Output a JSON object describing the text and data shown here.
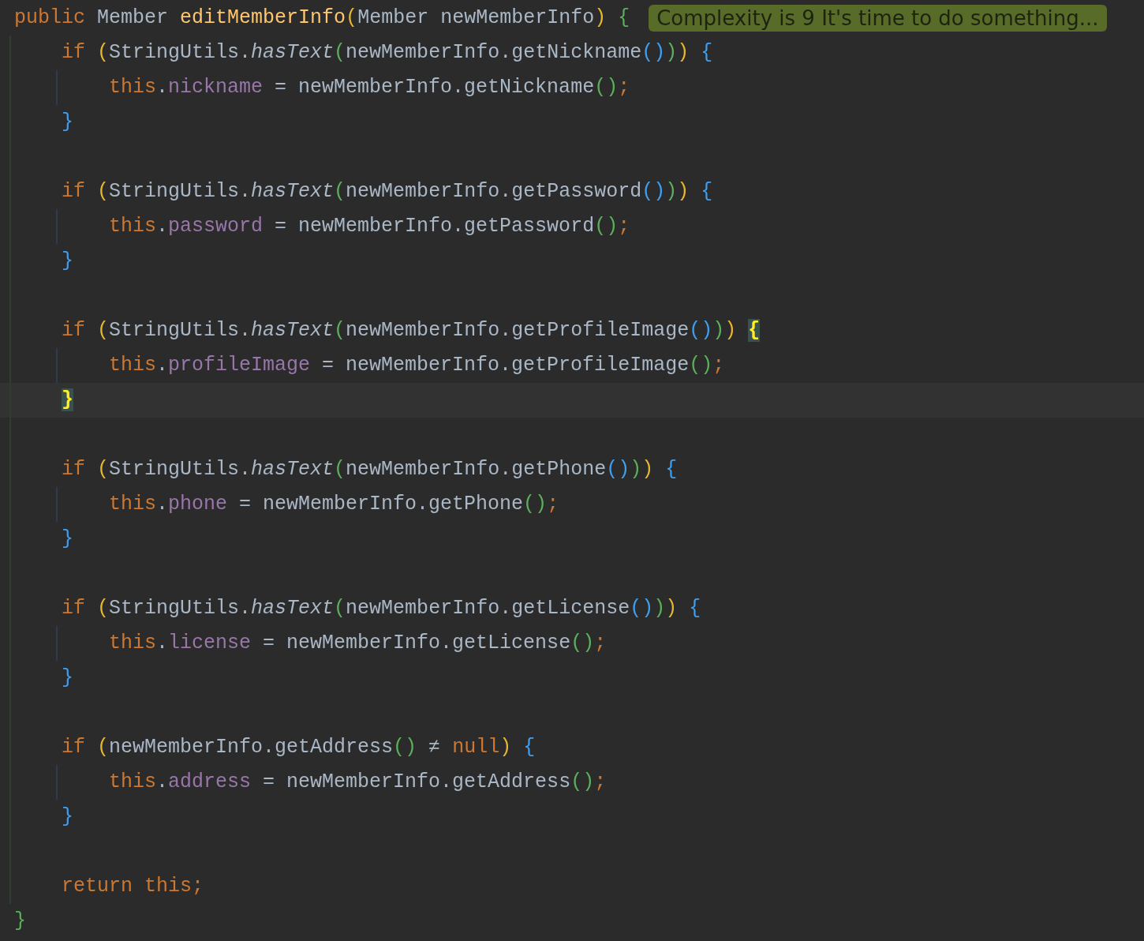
{
  "hint": {
    "text": "Complexity is 9 It's time to do something..."
  },
  "lines": [
    {
      "kind": "top",
      "tokens": [
        {
          "text": "public ",
          "kind": "keyword"
        },
        {
          "text": "Member ",
          "kind": "plain"
        },
        {
          "text": "editMemberInfo",
          "kind": "decl"
        },
        {
          "text": "(",
          "kind": "p1"
        },
        {
          "text": "Member newMemberInfo",
          "kind": "plain"
        },
        {
          "text": ") ",
          "kind": "p1"
        },
        {
          "text": "{",
          "kind": "p2"
        }
      ]
    },
    {
      "kind": "block",
      "tokens": [
        {
          "text": "if ",
          "kind": "keyword"
        },
        {
          "text": "(",
          "kind": "p1"
        },
        {
          "text": "StringUtils.",
          "kind": "plain"
        },
        {
          "text": "hasText",
          "kind": "static"
        },
        {
          "text": "(",
          "kind": "p2"
        },
        {
          "text": "newMemberInfo.getNickname",
          "kind": "plain"
        },
        {
          "text": "()",
          "kind": "p3"
        },
        {
          "text": ")",
          "kind": "p2"
        },
        {
          "text": ") ",
          "kind": "p1"
        },
        {
          "text": "{",
          "kind": "p3"
        }
      ]
    },
    {
      "kind": "body",
      "tokens": [
        {
          "text": "this",
          "kind": "keyword"
        },
        {
          "text": ".",
          "kind": "plain"
        },
        {
          "text": "nickname",
          "kind": "field"
        },
        {
          "text": " = newMemberInfo.getNickname",
          "kind": "plain"
        },
        {
          "text": "()",
          "kind": "p2"
        },
        {
          "text": ";",
          "kind": "keyword"
        }
      ]
    },
    {
      "kind": "block",
      "tokens": [
        {
          "text": "}",
          "kind": "p3"
        }
      ]
    },
    {
      "kind": "blank"
    },
    {
      "kind": "block",
      "tokens": [
        {
          "text": "if ",
          "kind": "keyword"
        },
        {
          "text": "(",
          "kind": "p1"
        },
        {
          "text": "StringUtils.",
          "kind": "plain"
        },
        {
          "text": "hasText",
          "kind": "static"
        },
        {
          "text": "(",
          "kind": "p2"
        },
        {
          "text": "newMemberInfo.getPassword",
          "kind": "plain"
        },
        {
          "text": "()",
          "kind": "p3"
        },
        {
          "text": ")",
          "kind": "p2"
        },
        {
          "text": ") ",
          "kind": "p1"
        },
        {
          "text": "{",
          "kind": "p3"
        }
      ]
    },
    {
      "kind": "body",
      "tokens": [
        {
          "text": "this",
          "kind": "keyword"
        },
        {
          "text": ".",
          "kind": "plain"
        },
        {
          "text": "password",
          "kind": "field"
        },
        {
          "text": " = newMemberInfo.getPassword",
          "kind": "plain"
        },
        {
          "text": "()",
          "kind": "p2"
        },
        {
          "text": ";",
          "kind": "keyword"
        }
      ]
    },
    {
      "kind": "block",
      "tokens": [
        {
          "text": "}",
          "kind": "p3"
        }
      ]
    },
    {
      "kind": "blank"
    },
    {
      "kind": "block",
      "tokens": [
        {
          "text": "if ",
          "kind": "keyword"
        },
        {
          "text": "(",
          "kind": "p1"
        },
        {
          "text": "StringUtils.",
          "kind": "plain"
        },
        {
          "text": "hasText",
          "kind": "static"
        },
        {
          "text": "(",
          "kind": "p2"
        },
        {
          "text": "newMemberInfo.getProfileImage",
          "kind": "plain"
        },
        {
          "text": "()",
          "kind": "p3"
        },
        {
          "text": ")",
          "kind": "p2"
        },
        {
          "text": ") ",
          "kind": "p1"
        },
        {
          "text": "{",
          "matched": true
        }
      ]
    },
    {
      "kind": "body",
      "tokens": [
        {
          "text": "this",
          "kind": "keyword"
        },
        {
          "text": ".",
          "kind": "plain"
        },
        {
          "text": "profileImage",
          "kind": "field"
        },
        {
          "text": " = newMemberInfo.getProfileImage",
          "kind": "plain"
        },
        {
          "text": "()",
          "kind": "p2"
        },
        {
          "text": ";",
          "kind": "keyword"
        }
      ]
    },
    {
      "kind": "block",
      "current": true,
      "tokens": [
        {
          "text": "}",
          "matched": true
        }
      ]
    },
    {
      "kind": "blank"
    },
    {
      "kind": "block",
      "tokens": [
        {
          "text": "if ",
          "kind": "keyword"
        },
        {
          "text": "(",
          "kind": "p1"
        },
        {
          "text": "StringUtils.",
          "kind": "plain"
        },
        {
          "text": "hasText",
          "kind": "static"
        },
        {
          "text": "(",
          "kind": "p2"
        },
        {
          "text": "newMemberInfo.getPhone",
          "kind": "plain"
        },
        {
          "text": "()",
          "kind": "p3"
        },
        {
          "text": ")",
          "kind": "p2"
        },
        {
          "text": ") ",
          "kind": "p1"
        },
        {
          "text": "{",
          "kind": "p3"
        }
      ]
    },
    {
      "kind": "body",
      "tokens": [
        {
          "text": "this",
          "kind": "keyword"
        },
        {
          "text": ".",
          "kind": "plain"
        },
        {
          "text": "phone",
          "kind": "field"
        },
        {
          "text": " = newMemberInfo.getPhone",
          "kind": "plain"
        },
        {
          "text": "()",
          "kind": "p2"
        },
        {
          "text": ";",
          "kind": "keyword"
        }
      ]
    },
    {
      "kind": "block",
      "tokens": [
        {
          "text": "}",
          "kind": "p3"
        }
      ]
    },
    {
      "kind": "blank"
    },
    {
      "kind": "block",
      "tokens": [
        {
          "text": "if ",
          "kind": "keyword"
        },
        {
          "text": "(",
          "kind": "p1"
        },
        {
          "text": "StringUtils.",
          "kind": "plain"
        },
        {
          "text": "hasText",
          "kind": "static"
        },
        {
          "text": "(",
          "kind": "p2"
        },
        {
          "text": "newMemberInfo.getLicense",
          "kind": "plain"
        },
        {
          "text": "()",
          "kind": "p3"
        },
        {
          "text": ")",
          "kind": "p2"
        },
        {
          "text": ") ",
          "kind": "p1"
        },
        {
          "text": "{",
          "kind": "p3"
        }
      ]
    },
    {
      "kind": "body",
      "tokens": [
        {
          "text": "this",
          "kind": "keyword"
        },
        {
          "text": ".",
          "kind": "plain"
        },
        {
          "text": "license",
          "kind": "field"
        },
        {
          "text": " = newMemberInfo.getLicense",
          "kind": "plain"
        },
        {
          "text": "()",
          "kind": "p2"
        },
        {
          "text": ";",
          "kind": "keyword"
        }
      ]
    },
    {
      "kind": "block",
      "tokens": [
        {
          "text": "}",
          "kind": "p3"
        }
      ]
    },
    {
      "kind": "blank"
    },
    {
      "kind": "block",
      "tokens": [
        {
          "text": "if ",
          "kind": "keyword"
        },
        {
          "text": "(",
          "kind": "p1"
        },
        {
          "text": "newMemberInfo.getAddress",
          "kind": "plain"
        },
        {
          "text": "()",
          "kind": "p2"
        },
        {
          "text": " ≠ ",
          "kind": "plain"
        },
        {
          "text": "null",
          "kind": "keyword"
        },
        {
          "text": ") ",
          "kind": "p1"
        },
        {
          "text": "{",
          "kind": "p3"
        }
      ]
    },
    {
      "kind": "body",
      "tokens": [
        {
          "text": "this",
          "kind": "keyword"
        },
        {
          "text": ".",
          "kind": "plain"
        },
        {
          "text": "address",
          "kind": "field"
        },
        {
          "text": " = newMemberInfo.getAddress",
          "kind": "plain"
        },
        {
          "text": "()",
          "kind": "p2"
        },
        {
          "text": ";",
          "kind": "keyword"
        }
      ]
    },
    {
      "kind": "block",
      "tokens": [
        {
          "text": "}",
          "kind": "p3"
        }
      ]
    },
    {
      "kind": "blank"
    },
    {
      "kind": "block",
      "tokens": [
        {
          "text": "return this;",
          "kind": "keyword"
        }
      ]
    },
    {
      "kind": "top",
      "tokens": [
        {
          "text": "}",
          "kind": "p2"
        }
      ]
    }
  ]
}
